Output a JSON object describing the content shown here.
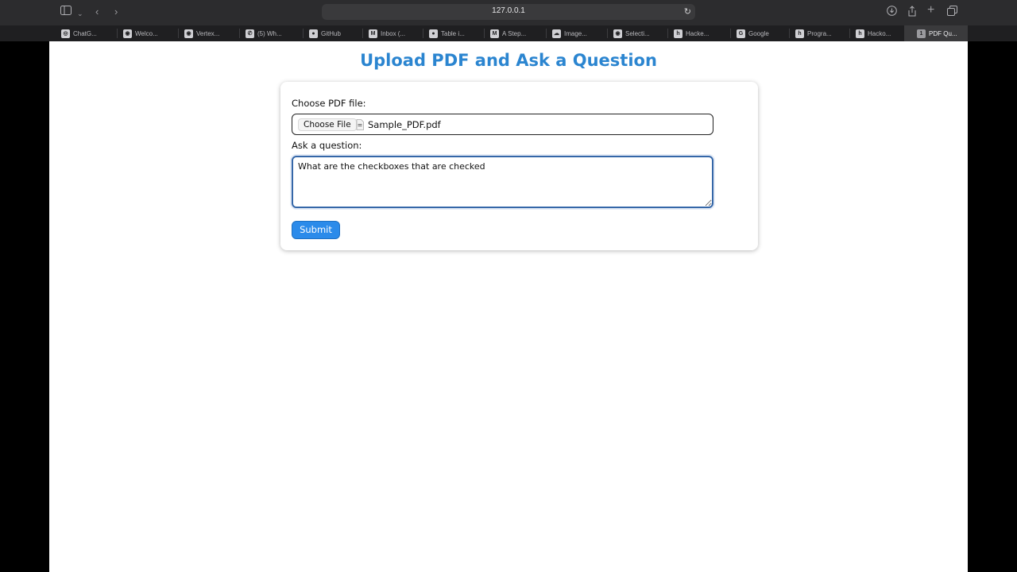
{
  "browser": {
    "url": "127.0.0.1",
    "tabs": [
      {
        "label": "ChatG...",
        "icon": "chatgpt-icon"
      },
      {
        "label": "Welco...",
        "icon": "site-icon"
      },
      {
        "label": "Vertex...",
        "icon": "site-icon"
      },
      {
        "label": "(5) Wh...",
        "icon": "whatsapp-icon"
      },
      {
        "label": "GitHub",
        "icon": "github-icon"
      },
      {
        "label": "Inbox (...",
        "icon": "gmail-icon"
      },
      {
        "label": "Table i...",
        "icon": "github-icon"
      },
      {
        "label": "A Step...",
        "icon": "medium-icon"
      },
      {
        "label": "Image...",
        "icon": "google-cloud-icon"
      },
      {
        "label": "Selecti...",
        "icon": "site-icon"
      },
      {
        "label": "Hacke...",
        "icon": "hackernoon-icon"
      },
      {
        "label": "Google",
        "icon": "google-icon"
      },
      {
        "label": "Progra...",
        "icon": "hackernoon-icon"
      },
      {
        "label": "Hacko...",
        "icon": "hackernoon-icon"
      },
      {
        "label": "PDF Qu...",
        "icon": "tab-count-icon",
        "active": true,
        "badge": "1"
      }
    ]
  },
  "page": {
    "title": "Upload PDF and Ask a Question",
    "pdf_label": "Choose PDF file:",
    "choose_file_button": "Choose File",
    "selected_file": "Sample_PDF.pdf",
    "question_label": "Ask a question:",
    "question_value": "What are the checkboxes that are checked",
    "submit_label": "Submit"
  },
  "colors": {
    "title": "#2b85d0",
    "submit": "#2b8bea",
    "focus_border": "#3567a8"
  }
}
